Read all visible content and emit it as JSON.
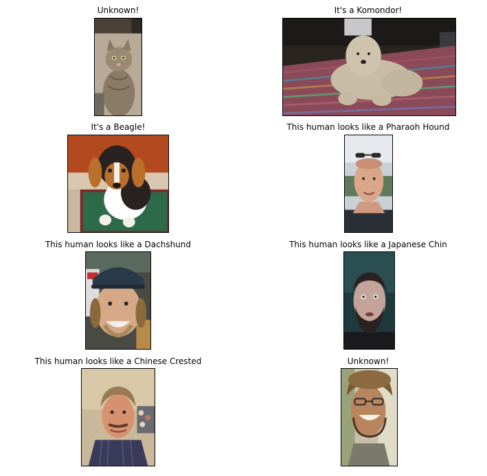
{
  "panels": [
    {
      "title": "Unknown!",
      "subject": "cat"
    },
    {
      "title": "It's a Komondor!",
      "subject": "dog"
    },
    {
      "title": "It's a Beagle!",
      "subject": "dog"
    },
    {
      "title": "This human looks like a Pharaoh Hound",
      "subject": "human"
    },
    {
      "title": "This human looks like a Dachshund",
      "subject": "human"
    },
    {
      "title": "This human looks like a Japanese Chin",
      "subject": "human"
    },
    {
      "title": "This human looks like a Chinese Crested",
      "subject": "human"
    },
    {
      "title": "Unknown!",
      "subject": "human"
    }
  ]
}
